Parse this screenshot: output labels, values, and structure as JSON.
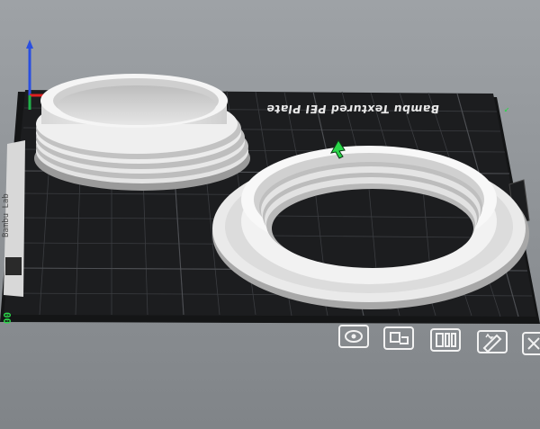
{
  "plate": {
    "label": "Bambu Textured PEI Plate",
    "origin_label": "00",
    "side_label": "Bambu Lab"
  },
  "toolbar": {
    "buttons": [
      {
        "name": "orient-button",
        "icon": "orient-icon"
      },
      {
        "name": "arrange-button",
        "icon": "arrange-icon"
      },
      {
        "name": "layout-button",
        "icon": "layout-icon"
      },
      {
        "name": "edit-plate-button",
        "icon": "edit-plate-icon"
      },
      {
        "name": "close-plate-button",
        "icon": "close-icon"
      }
    ]
  },
  "colors": {
    "background": "#8e9296",
    "plate": "#1c1d1f",
    "grid": "#3a3c3f",
    "model": "#ececec",
    "accent": "#2bd64a",
    "axis_x": "#e02020",
    "axis_y": "#21b04a",
    "axis_z": "#2a4fe0"
  }
}
